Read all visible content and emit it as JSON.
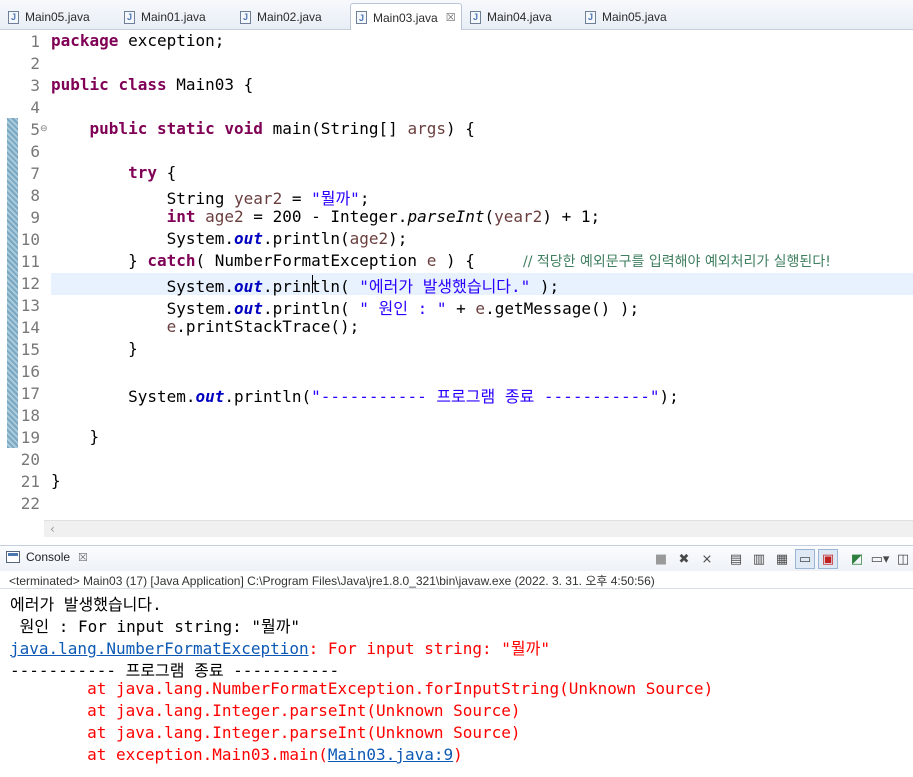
{
  "tabs": [
    {
      "label": "Main05.java",
      "active": false
    },
    {
      "label": "Main01.java",
      "active": false
    },
    {
      "label": "Main02.java",
      "active": false
    },
    {
      "label": "Main03.java",
      "active": true
    },
    {
      "label": "Main04.java",
      "active": false
    },
    {
      "label": "Main05.java",
      "active": false
    }
  ],
  "editor": {
    "line_numbers": [
      "1",
      "2",
      "3",
      "4",
      "5",
      "6",
      "7",
      "8",
      "9",
      "10",
      "11",
      "12",
      "13",
      "14",
      "15",
      "16",
      "17",
      "18",
      "19",
      "20",
      "21",
      "22"
    ],
    "code": {
      "l1": {
        "kw": "package",
        "rest": " exception;"
      },
      "l3": {
        "kw1": "public",
        "kw2": "class",
        "rest": " Main03 {"
      },
      "l5": {
        "kw1": "public",
        "kw2": "static",
        "kw3": "void",
        "rest": " main(String[] ",
        "var": "args",
        "end": ") {"
      },
      "l7": {
        "kw": "try",
        "rest": " {"
      },
      "l8": {
        "a": "String ",
        "var": "year2",
        "b": " = ",
        "str": "\"뭘까\"",
        "c": ";"
      },
      "l9": {
        "kw": "int",
        "var": " age2",
        "a": " = 200 - Integer.",
        "method": "parseInt",
        "b": "(",
        "var2": "year2",
        "c": ") + 1;"
      },
      "l10": {
        "a": "System.",
        "fld": "out",
        "b": ".println(",
        "var": "age2",
        "c": ");"
      },
      "l11": {
        "a": "} ",
        "kw": "catch",
        "b": "( NumberFormatException ",
        "var": "e",
        "c": " ) {     ",
        "cmt": "// 적당한 예외문구를 입력해야 예외처리가 실행된다!"
      },
      "l12": {
        "a": "System.",
        "fld": "out",
        "b": ".println( ",
        "str": "\"에러가 발생했습니다.\"",
        "c": " );"
      },
      "l13": {
        "a": "System.",
        "fld": "out",
        "b": ".println( ",
        "str": "\" 원인 : \"",
        "c": " + ",
        "var": "e",
        "d": ".getMessage() );"
      },
      "l14": {
        "var": "e",
        "a": ".printStackTrace();"
      },
      "l15": {
        "a": "}"
      },
      "l17": {
        "a": "System.",
        "fld": "out",
        "b": ".println(",
        "str": "\"----------- 프로그램 종료 -----------\"",
        "c": ");"
      },
      "l19": {
        "a": "}"
      },
      "l21": {
        "a": "}"
      }
    }
  },
  "console": {
    "tab_label": "Console",
    "status": "<terminated> Main03 (17) [Java Application] C:\\Program Files\\Java\\jre1.8.0_321\\bin\\javaw.exe (2022. 3. 31. 오후 4:50:56)",
    "output": {
      "line1": "에러가 발생했습니다.",
      "line2": " 원인 : For input string: \"뭘까\"",
      "line3_link": "java.lang.NumberFormatException",
      "line3_rest": ": For input string: \"뭘까\"",
      "line4": "----------- 프로그램 종료 -----------",
      "trace1": "        at java.lang.NumberFormatException.forInputString(Unknown Source)",
      "trace2": "        at java.lang.Integer.parseInt(Unknown Source)",
      "trace3": "        at java.lang.Integer.parseInt(Unknown Source)",
      "trace4_prefix": "        at exception.Main03.main(",
      "trace4_link": "Main03.java:9",
      "trace4_suffix": ")"
    }
  },
  "icons": [
    "java-file-icon",
    "close-icon",
    "console-icon",
    "terminate-icon",
    "remove-launch-icon",
    "remove-all-icon",
    "clear-console-icon",
    "scroll-lock-icon",
    "word-wrap-icon",
    "show-on-output-icon",
    "show-on-error-icon",
    "pin-console-icon",
    "display-console-icon",
    "open-console-icon"
  ],
  "colors": {
    "keyword": "#7f0055",
    "string": "#2a00ff",
    "field": "#0000c0",
    "comment": "#3f7f5f",
    "error": "#ff0000",
    "link": "#0c59b5"
  }
}
